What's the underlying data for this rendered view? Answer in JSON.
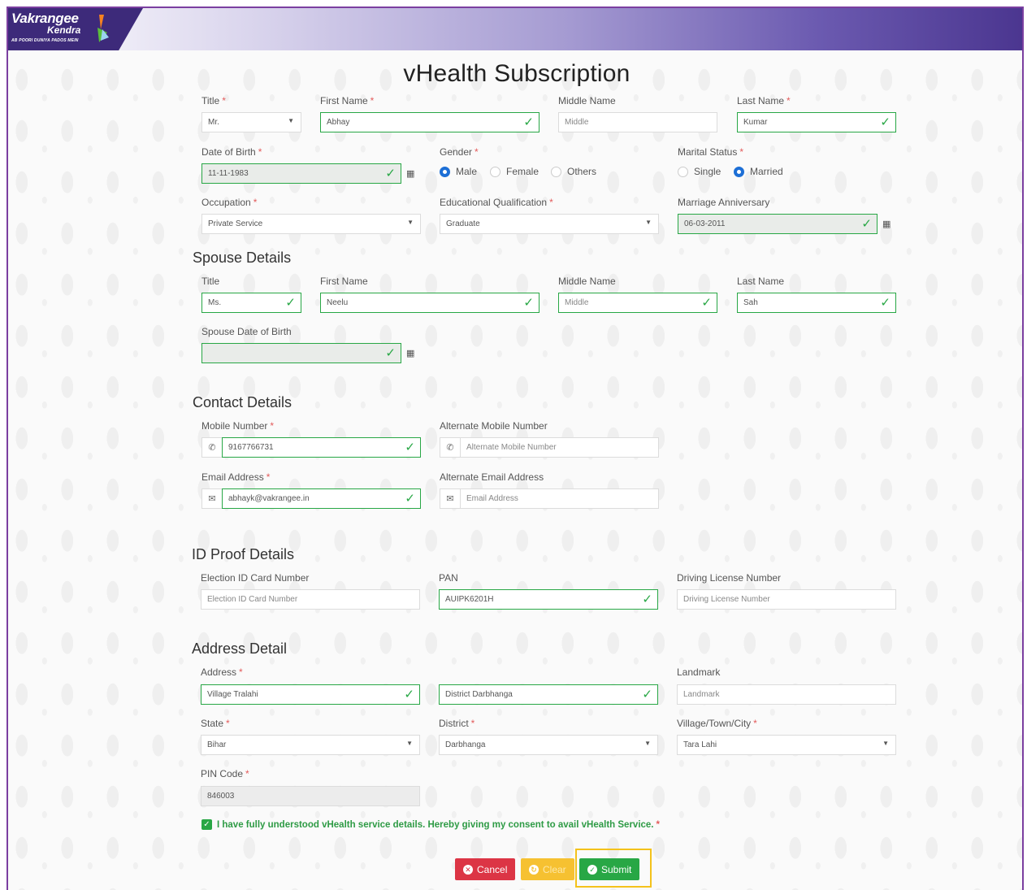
{
  "header": {
    "brand": "Vakrangee",
    "sub_brand": "Kendra",
    "tagline": "AB POORI DUNIYA PADOS MEIN"
  },
  "page_title": "vHealth Subscription",
  "personal": {
    "title_label": "Title",
    "title_value": "Mr.",
    "first_name_label": "First Name",
    "first_name_value": "Abhay",
    "middle_name_label": "Middle Name",
    "middle_name_placeholder": "Middle",
    "last_name_label": "Last Name",
    "last_name_value": "Kumar",
    "dob_label": "Date of Birth",
    "dob_value": "11-11-1983",
    "gender_label": "Gender",
    "gender_options": [
      "Male",
      "Female",
      "Others"
    ],
    "gender_selected": "Male",
    "marital_label": "Marital Status",
    "marital_options": [
      "Single",
      "Married"
    ],
    "marital_selected": "Married",
    "occupation_label": "Occupation",
    "occupation_value": "Private Service",
    "education_label": "Educational Qualification",
    "education_value": "Graduate",
    "anniversary_label": "Marriage Anniversary",
    "anniversary_value": "06-03-2011"
  },
  "spouse": {
    "heading": "Spouse Details",
    "title_label": "Title",
    "title_value": "Ms.",
    "first_name_label": "First Name",
    "first_name_value": "Neelu",
    "middle_name_label": "Middle Name",
    "middle_name_placeholder": "Middle",
    "last_name_label": "Last Name",
    "last_name_value": "Sah",
    "dob_label": "Spouse Date of Birth",
    "dob_value": ""
  },
  "contact": {
    "heading": "Contact Details",
    "mobile_label": "Mobile Number",
    "mobile_value": "9167766731",
    "alt_mobile_label": "Alternate Mobile Number",
    "alt_mobile_placeholder": "Alternate Mobile Number",
    "email_label": "Email Address",
    "email_value": "abhayk@vakrangee.in",
    "alt_email_label": "Alternate Email Address",
    "alt_email_placeholder": "Email Address"
  },
  "id_proof": {
    "heading": "ID Proof Details",
    "election_label": "Election ID Card Number",
    "election_placeholder": "Election ID Card Number",
    "pan_label": "PAN",
    "pan_value": "AUIPK6201H",
    "dl_label": "Driving License Number",
    "dl_placeholder": "Driving License Number"
  },
  "address": {
    "heading": "Address Detail",
    "address_label": "Address",
    "address_line1": "Village Tralahi",
    "address_line2": "District  Darbhanga",
    "landmark_label": "Landmark",
    "landmark_placeholder": "Landmark",
    "state_label": "State",
    "state_value": "Bihar",
    "district_label": "District",
    "district_value": "Darbhanga",
    "village_label": "Village/Town/City",
    "village_value": "Tara Lahi",
    "pin_label": "PIN Code",
    "pin_value": "846003"
  },
  "consent_text": "I have fully understood vHealth service details. Hereby giving my consent to avail vHealth Service.",
  "buttons": {
    "cancel": "Cancel",
    "clear": "Clear",
    "submit": "Submit"
  },
  "colors": {
    "valid_green": "#28a745",
    "required_red": "#e35b5b",
    "header_purple": "#3d2a7a",
    "cancel_red": "#dc3545",
    "clear_yellow": "#f6c131",
    "highlight_yellow": "#f4c21b"
  },
  "icons": {
    "phone": "phone-icon",
    "envelope": "envelope-icon",
    "calendar": "calendar-icon",
    "check": "check-icon"
  }
}
